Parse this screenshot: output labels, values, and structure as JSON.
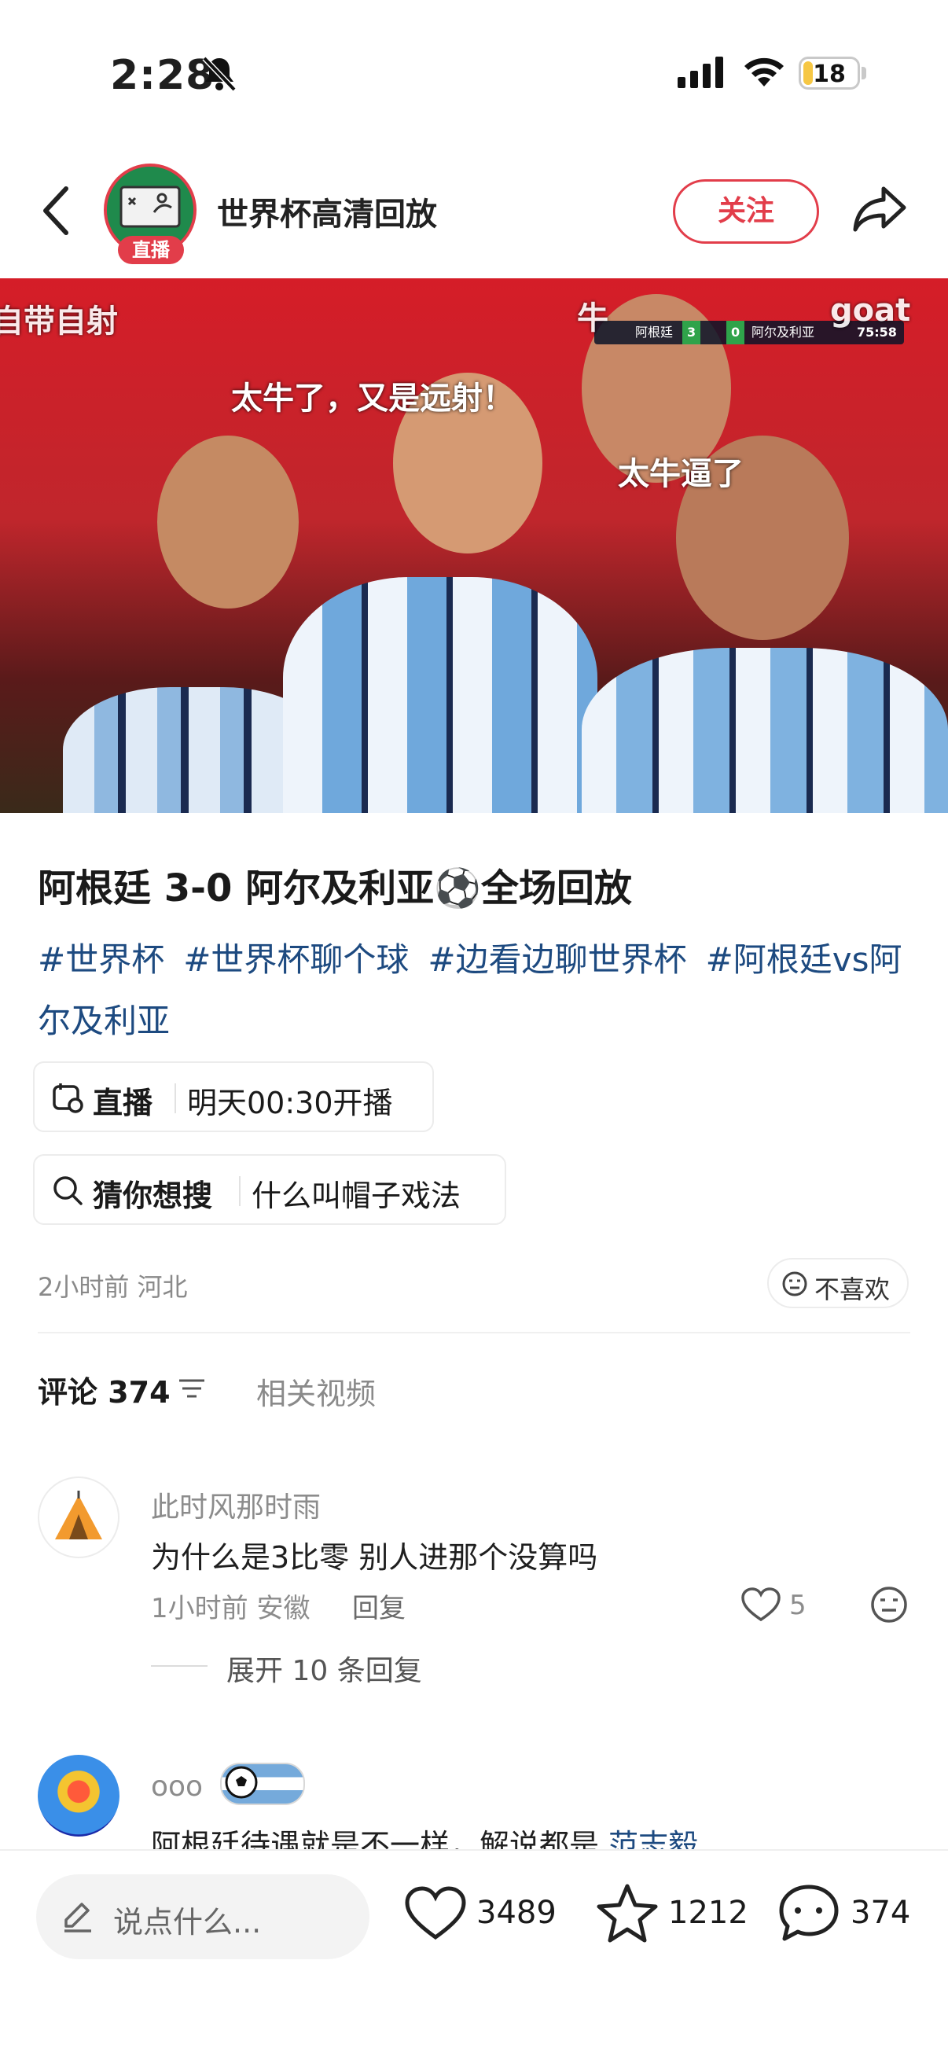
{
  "status_bar": {
    "time": "2:28",
    "battery": "18",
    "battery_level": 0.18,
    "bell_icon": "bell-muted-icon"
  },
  "header": {
    "channel_name": "世界杯高清回放",
    "live_badge": "直播",
    "follow_label": "关注",
    "icons": [
      "back-chevron-icon",
      "share-icon"
    ]
  },
  "video": {
    "danmaku": [
      "太牛了，又是远射！",
      "太牛逼了",
      "自带自射",
      "牛",
      "goat"
    ],
    "scoreboard": {
      "home": "阿根廷",
      "home_score": "3",
      "away_score": "0",
      "away": "阿尔及利亚",
      "clock": "75:58"
    }
  },
  "post": {
    "title": "阿根廷 3-0 阿尔及利亚⚽全场回放",
    "tags": [
      "#世界杯",
      "#世界杯聊个球",
      "#边看边聊世界杯",
      "#阿根廷vs阿尔及利亚"
    ],
    "live_chip": {
      "label": "直播",
      "value": "明天00:30开播"
    },
    "search_chip": {
      "label": "猜你想搜",
      "value": "什么叫帽子戏法"
    },
    "meta": "2小时前 河北",
    "dislike_label": "不喜欢"
  },
  "tabs": {
    "comments_label": "评论 374",
    "related_label": "相关视频"
  },
  "comments": [
    {
      "name": "此时风那时雨",
      "text": "为什么是3比零  别人进那个没算吗",
      "meta": "1小时前 安徽",
      "reply_label": "回复",
      "likes": "5",
      "expand_label": "展开 10 条回复"
    },
    {
      "name": "ooo",
      "text": "阿根廷待遇就是不一样，解说都是",
      "mention": "范志毅"
    }
  ],
  "bottom_bar": {
    "input_placeholder": "说点什么...",
    "likes": "3489",
    "favorites": "1212",
    "comments": "374"
  },
  "colors": {
    "accent_red": "#e23d4a",
    "tag_blue": "#1d4a80",
    "muted_gray": "#8a8a8a"
  }
}
